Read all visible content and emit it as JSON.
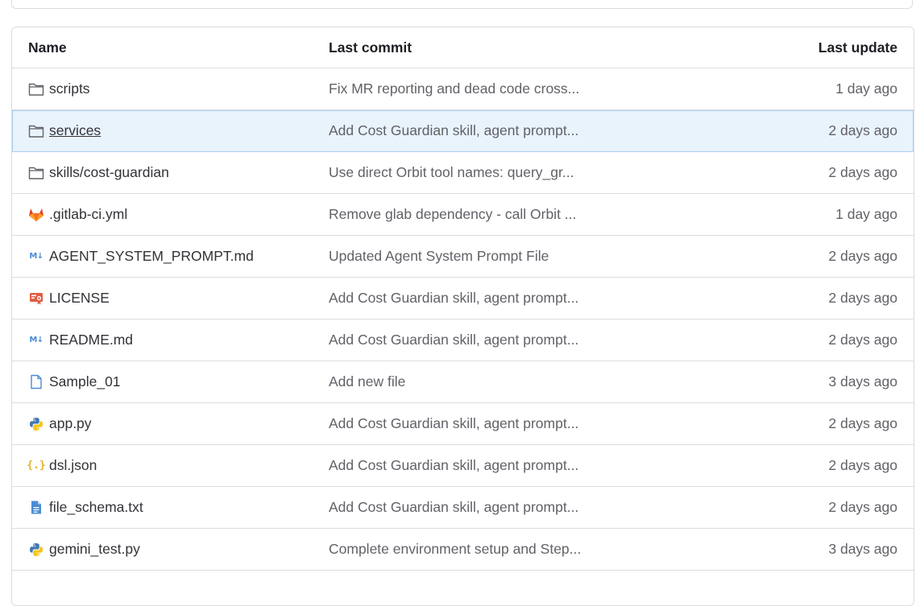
{
  "table": {
    "headers": {
      "name": "Name",
      "last_commit": "Last commit",
      "last_update": "Last update"
    },
    "rows": [
      {
        "icon": "folder-icon",
        "name": "scripts",
        "commit": "Fix MR reporting and dead code cross...",
        "updated": "1 day ago"
      },
      {
        "icon": "folder-icon",
        "name": "services",
        "commit": "Add Cost Guardian skill, agent prompt...",
        "updated": "2 days ago",
        "highlighted": true
      },
      {
        "icon": "folder-icon",
        "name": "skills/cost-guardian",
        "commit": "Use direct Orbit tool names: query_gr...",
        "updated": "2 days ago"
      },
      {
        "icon": "gitlab-icon",
        "name": ".gitlab-ci.yml",
        "commit": "Remove glab dependency - call Orbit ...",
        "updated": "1 day ago"
      },
      {
        "icon": "markdown-icon",
        "name": "AGENT_SYSTEM_PROMPT.md",
        "commit": "Updated Agent System Prompt File",
        "updated": "2 days ago"
      },
      {
        "icon": "license-icon",
        "name": "LICENSE",
        "commit": "Add Cost Guardian skill, agent prompt...",
        "updated": "2 days ago"
      },
      {
        "icon": "markdown-icon",
        "name": "README.md",
        "commit": "Add Cost Guardian skill, agent prompt...",
        "updated": "2 days ago"
      },
      {
        "icon": "file-icon",
        "name": "Sample_01",
        "commit": "Add new file",
        "updated": "3 days ago"
      },
      {
        "icon": "python-icon",
        "name": "app.py",
        "commit": "Add Cost Guardian skill, agent prompt...",
        "updated": "2 days ago"
      },
      {
        "icon": "json-icon",
        "name": "dsl.json",
        "commit": "Add Cost Guardian skill, agent prompt...",
        "updated": "2 days ago"
      },
      {
        "icon": "text-file-icon",
        "name": "file_schema.txt",
        "commit": "Add Cost Guardian skill, agent prompt...",
        "updated": "2 days ago"
      },
      {
        "icon": "python-icon",
        "name": "gemini_test.py",
        "commit": "Complete environment setup and Step...",
        "updated": "3 days ago"
      }
    ]
  },
  "colors": {
    "border": "#dcdcde",
    "highlight_bg": "#e9f3fc",
    "muted_text": "#626168",
    "gitlab_orange": "#e24329",
    "markdown_blue": "#4a8bd6",
    "json_yellow": "#e6b325"
  }
}
